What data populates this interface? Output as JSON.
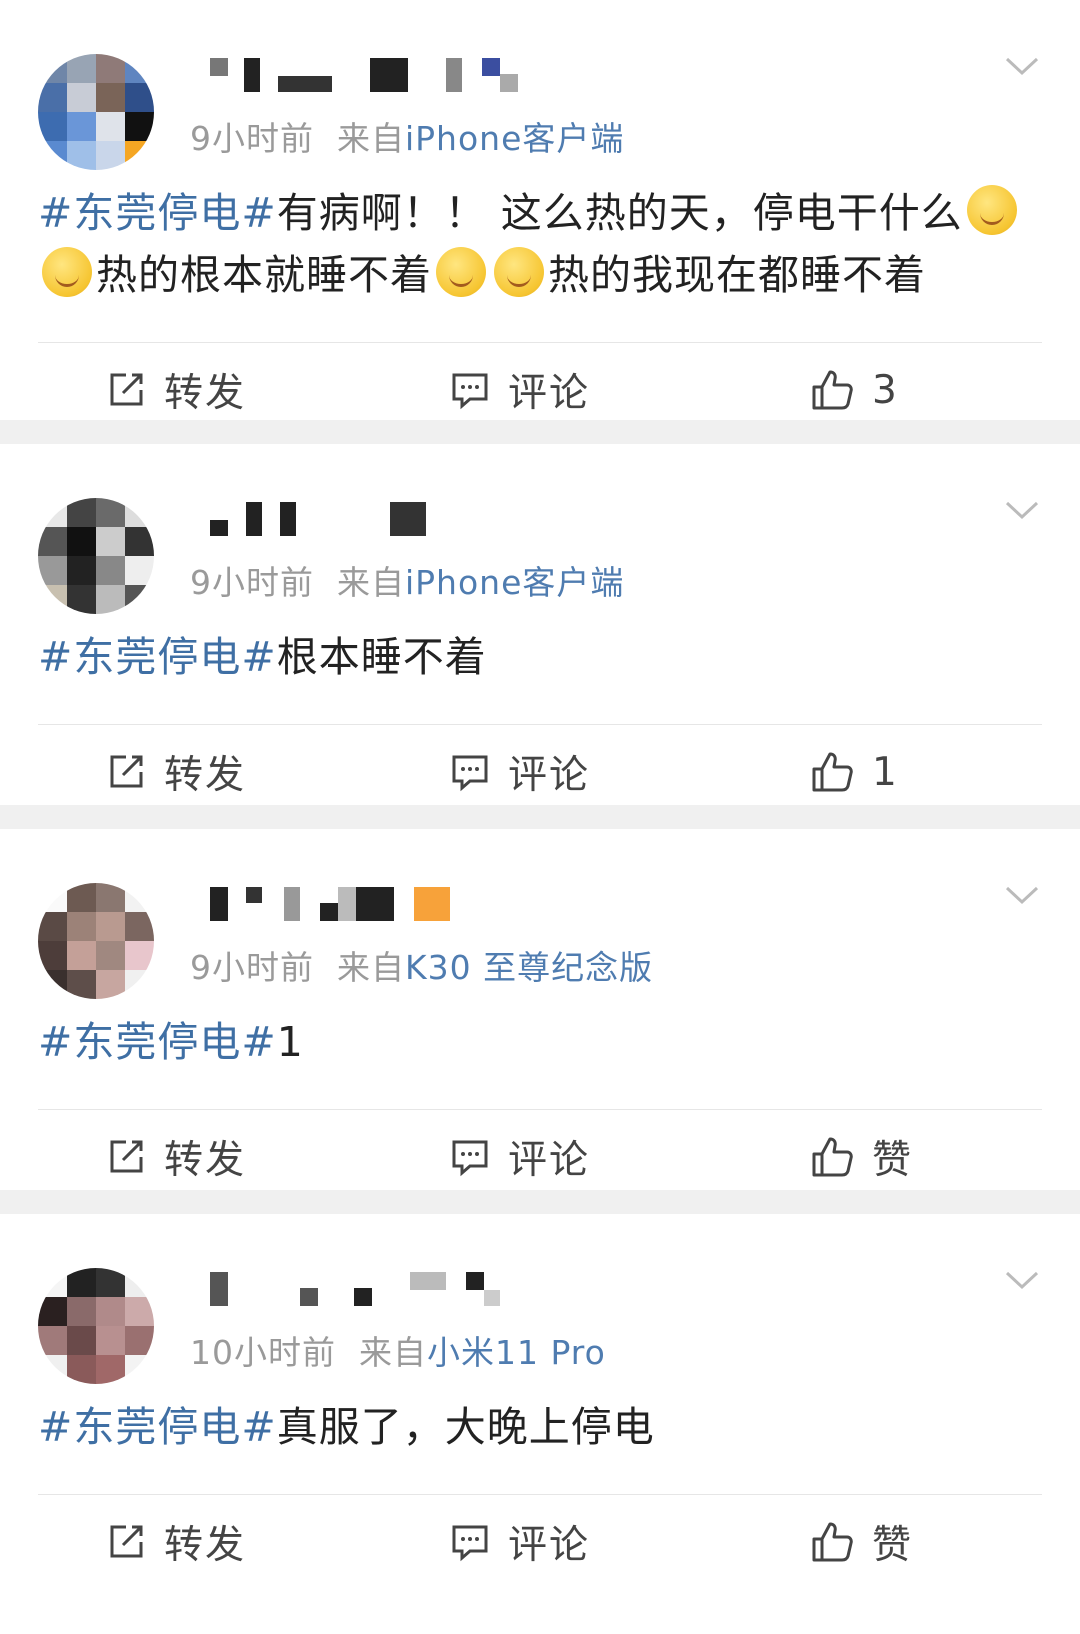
{
  "posts": [
    {
      "time": "9小时前",
      "from": "来自",
      "source": "iPhone客户端",
      "hashtag": "#东莞停电#",
      "text_a": "有病啊！！ 这么热的天，停电干什么",
      "text_b": "热的根本就睡不着",
      "text_c": "热的我现在都睡不着",
      "repost": "转发",
      "comment": "评论",
      "like": "3"
    },
    {
      "time": "9小时前",
      "from": "来自",
      "source": "iPhone客户端",
      "hashtag": "#东莞停电#",
      "text_a": "根本睡不着",
      "repost": "转发",
      "comment": "评论",
      "like": "1"
    },
    {
      "time": "9小时前",
      "from": "来自",
      "source": "K30 至尊纪念版",
      "hashtag": "#东莞停电#",
      "text_a": "1",
      "repost": "转发",
      "comment": "评论",
      "like": "赞"
    },
    {
      "time": "10小时前",
      "from": "来自",
      "source": "小米11 Pro",
      "hashtag": "#东莞停电#",
      "text_a": "真服了，大晚上停电",
      "repost": "转发",
      "comment": "评论",
      "like": "赞"
    }
  ],
  "icons": {
    "repost": "repost-icon",
    "comment": "comment-icon",
    "like": "thumbs-up-icon",
    "more": "chevron-down-icon",
    "emoji": "emoji-icon"
  },
  "colors": {
    "hashtag": "#3f6fa4",
    "source": "#4f7cb0",
    "meta": "#9a9a9a"
  }
}
